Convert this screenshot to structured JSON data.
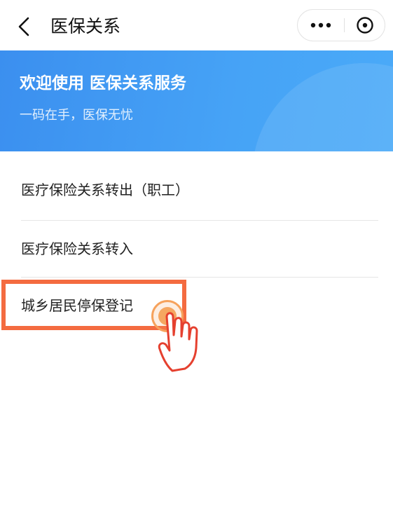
{
  "nav": {
    "title": "医保关系",
    "back_icon": "chevron-left-icon",
    "more_icon": "more-dots-icon",
    "close_icon": "close-circle-icon"
  },
  "banner": {
    "title": "欢迎使用 医保关系服务",
    "subtitle": "一码在手，医保无忧",
    "color": "#3b8fef"
  },
  "menu": {
    "items": [
      {
        "label": "医疗保险关系转出（职工）"
      },
      {
        "label": "医疗保险关系转入"
      },
      {
        "label": "城乡居民停保登记"
      }
    ]
  },
  "annotation": {
    "highlight_color": "#f46b40",
    "pointer_icon": "hand-pointer-icon"
  }
}
